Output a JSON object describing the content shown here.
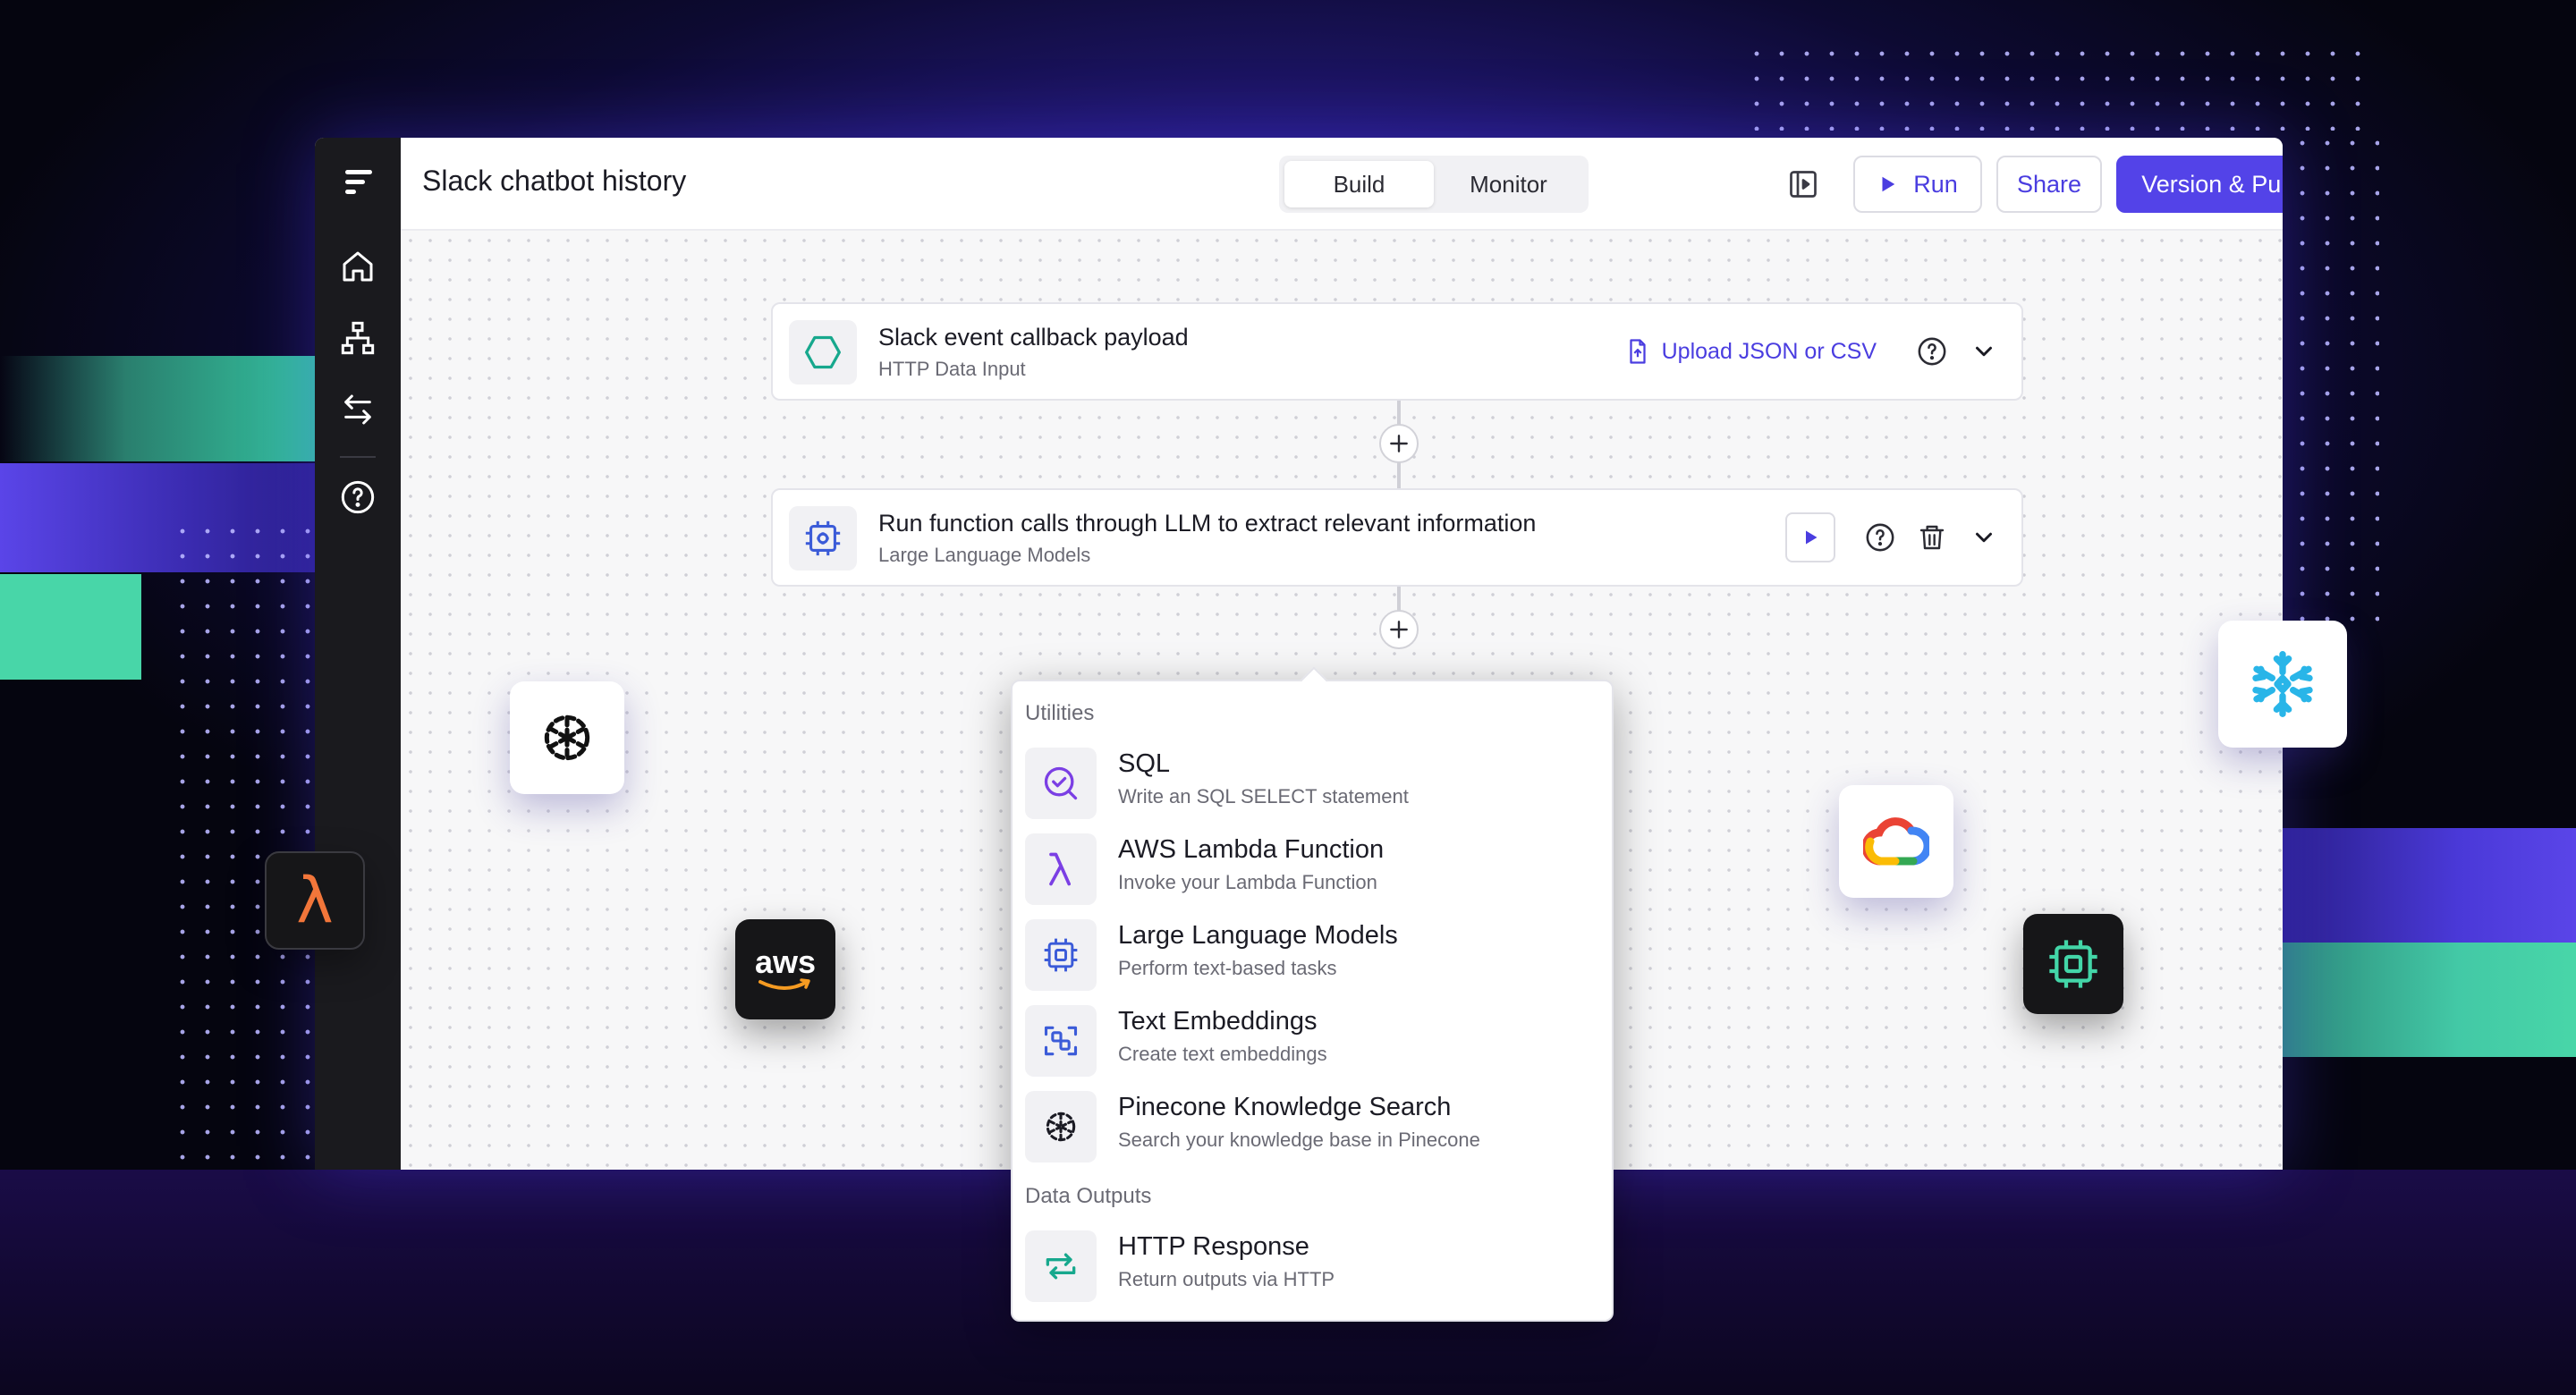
{
  "app": {
    "title": "Slack chatbot history"
  },
  "tabs": [
    {
      "label": "Build",
      "active": true
    },
    {
      "label": "Monitor",
      "active": false
    }
  ],
  "toolbar": {
    "run_label": "Run",
    "share_label": "Share",
    "publish_label": "Version & Publish"
  },
  "sidebar": {
    "items": [
      {
        "icon": "home-icon"
      },
      {
        "icon": "workflow-icon"
      },
      {
        "icon": "transfer-arrows-icon"
      },
      {
        "icon": "help-circle-icon"
      }
    ]
  },
  "nodes": [
    {
      "title": "Slack event callback payload",
      "subtitle": "HTTP Data Input",
      "icon": "hexagon-icon",
      "action_label": "Upload JSON or CSV"
    },
    {
      "title": "Run function calls through LLM to extract relevant information",
      "subtitle": "Large Language Models",
      "icon": "cpu-chip-icon"
    }
  ],
  "menu": {
    "sections": [
      {
        "header": "Utilities",
        "items": [
          {
            "title": "SQL",
            "subtitle": "Write an SQL SELECT statement",
            "icon": "search-check-icon"
          },
          {
            "title": "AWS Lambda Function",
            "subtitle": "Invoke your Lambda Function",
            "icon": "lambda-icon"
          },
          {
            "title": "Large Language Models",
            "subtitle": "Perform text-based tasks",
            "icon": "cpu-chip-icon"
          },
          {
            "title": "Text Embeddings",
            "subtitle": "Create text embeddings",
            "icon": "embeddings-icon"
          },
          {
            "title": "Pinecone Knowledge Search",
            "subtitle": "Search your knowledge base in Pinecone",
            "icon": "pinecone-icon"
          }
        ]
      },
      {
        "header": "Data Outputs",
        "items": [
          {
            "title": "HTTP Response",
            "subtitle": "Return outputs via HTTP",
            "icon": "loop-arrows-icon"
          }
        ]
      }
    ]
  },
  "floating_logos": {
    "aws_text": "aws",
    "lambda_glyph": "λ",
    "logos": [
      "pinecone-logo-icon",
      "lambda-logo-icon",
      "aws-logo-icon",
      "google-cloud-logo-icon",
      "snowflake-logo-icon",
      "chip-logo-icon"
    ]
  },
  "colors": {
    "accent": "#5343e8",
    "sidebar": "#1a1a1e",
    "teal": "#17a88d",
    "lambda_orange": "#f2763a",
    "snowflake": "#29b5e8"
  }
}
